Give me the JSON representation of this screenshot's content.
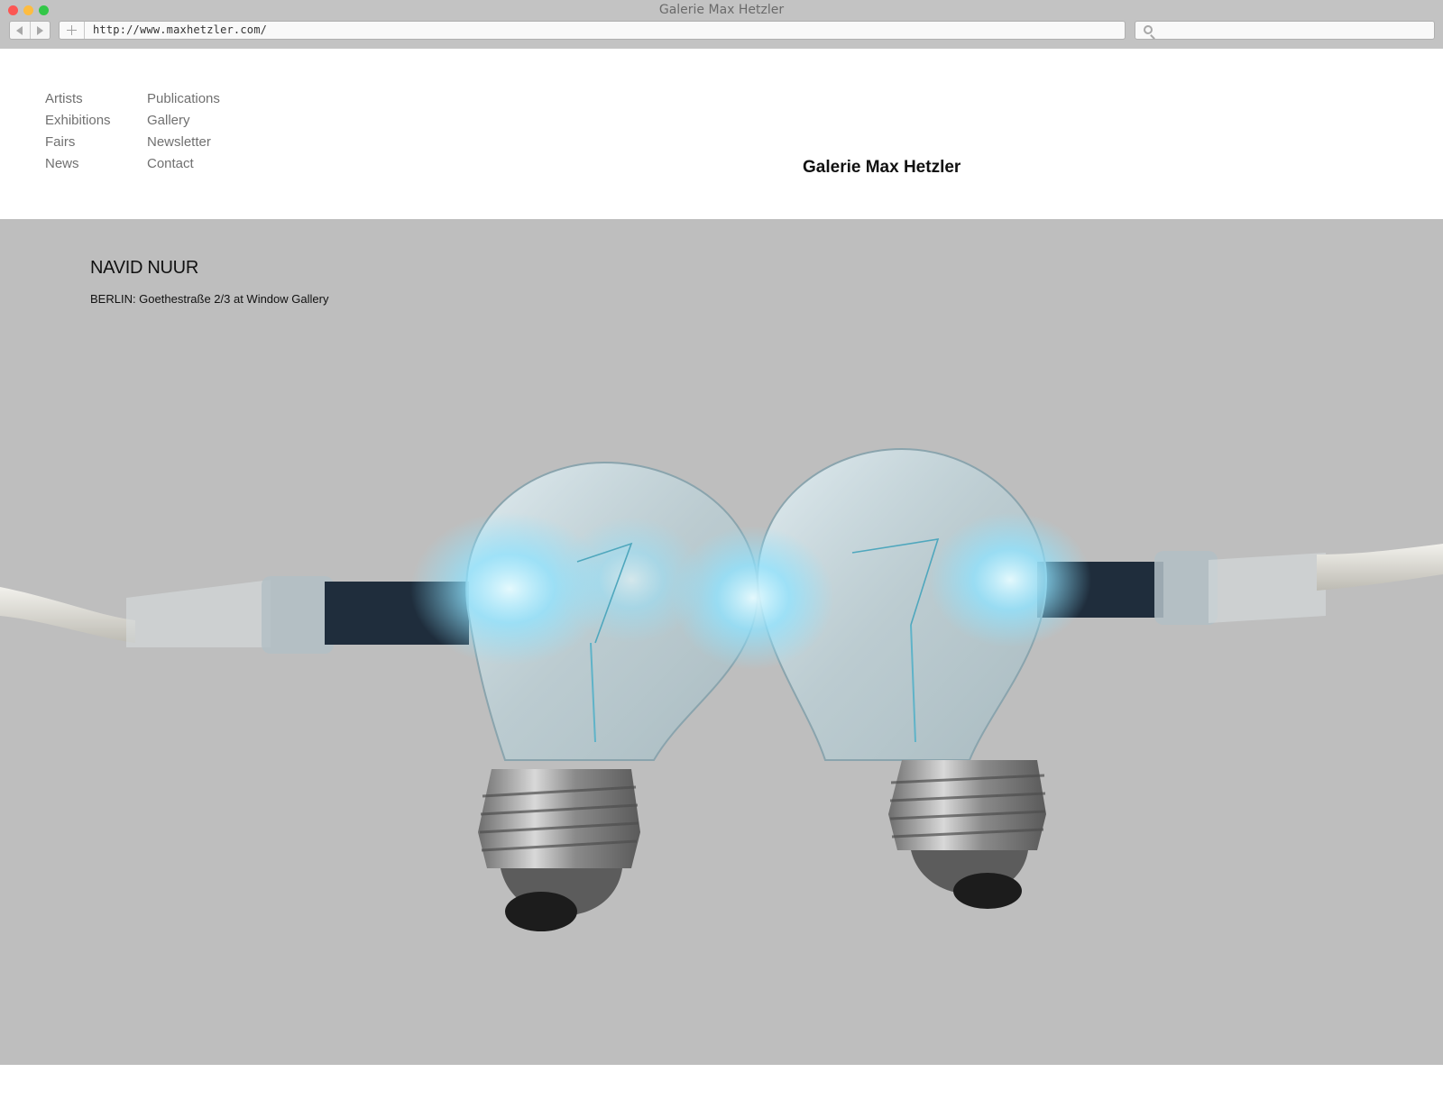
{
  "browser": {
    "window_title": "Galerie Max Hetzler",
    "url": "http://www.maxhetzler.com/"
  },
  "nav": {
    "col1": [
      "Artists",
      "Exhibitions",
      "Fairs",
      "News"
    ],
    "col2": [
      "Publications",
      "Gallery",
      "Newsletter",
      "Contact"
    ]
  },
  "brand": "Galerie Max Hetzler",
  "hero": {
    "title": "NAVID NUUR",
    "location": "BERLIN: Goethestraße 2/3 at Window Gallery"
  },
  "colors": {
    "hero_background": "#bebebe",
    "bulb_glow": "#8fe3ff",
    "chrome": "#c3c3c3"
  }
}
